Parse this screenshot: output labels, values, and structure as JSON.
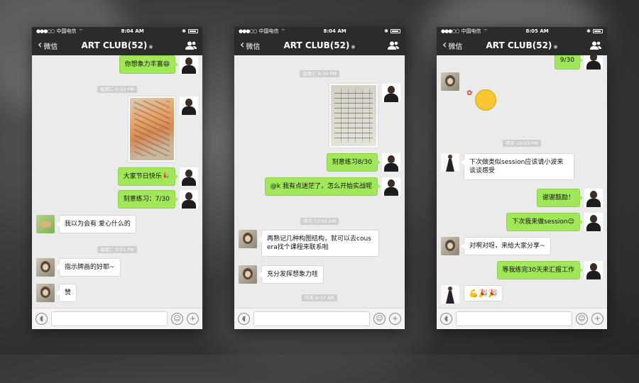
{
  "phones": [
    {
      "status": {
        "carrier": "中国电信",
        "time": "8:04 AM"
      },
      "nav": {
        "back": "微信",
        "title": "ART CLUB(52)"
      },
      "messages": [
        {
          "text": "你想象力丰富😄"
        },
        {
          "time": "星期二 6:50 PM"
        },
        {
          "text": "大家节日快乐🎉"
        },
        {
          "text": "刻意练习：7/30"
        },
        {
          "text": "我以为会有 爱心什么的"
        },
        {
          "time": "星期二 9:01 PM"
        },
        {
          "text": "指示牌画的好耶~"
        },
        {
          "text": "赞"
        }
      ]
    },
    {
      "status": {
        "carrier": "中国电信",
        "time": "8:04 AM"
      },
      "nav": {
        "back": "微信",
        "title": "ART CLUB(52)"
      },
      "messages": [
        {
          "time": "星期三 6:34 PM"
        },
        {
          "text": "刻意练习8/30"
        },
        {
          "text": "@k 我有点迷茫了，怎么开始实战呢"
        },
        {
          "time": "昨天 12:03 AM"
        },
        {
          "text": "再熟记几种构图结构，就可以去cousera找个课程来联系啦"
        },
        {
          "text": "充分发挥想象力哇"
        },
        {
          "time": "昨天 6:32 AM"
        }
      ]
    },
    {
      "status": {
        "carrier": "中国电信",
        "time": "8:05 AM"
      },
      "nav": {
        "back": "微信",
        "title": "ART CLUB(52)"
      },
      "messages": [
        {
          "text": "9/30"
        },
        {
          "time": "昨天 10:33 PM"
        },
        {
          "text": "下次做类似session应该请小波来谈谈感受"
        },
        {
          "text": "谢谢鼓励！"
        },
        {
          "text": "下次我来做session😉"
        },
        {
          "text": "对啊对呀，来给大家分享~"
        },
        {
          "text": "等我练完30天来汇报工作"
        },
        {
          "text": "💪🎉🎉"
        }
      ]
    }
  ],
  "icons": {
    "voice": "voice-icon",
    "emoji": "emoji-icon",
    "plus": "plus-icon",
    "people": "people-icon",
    "back": "chevron-left-icon"
  },
  "colors": {
    "green_bubble": "#a0e759",
    "navbar": "#2b2b2b",
    "chat_bg": "#ebebeb"
  }
}
